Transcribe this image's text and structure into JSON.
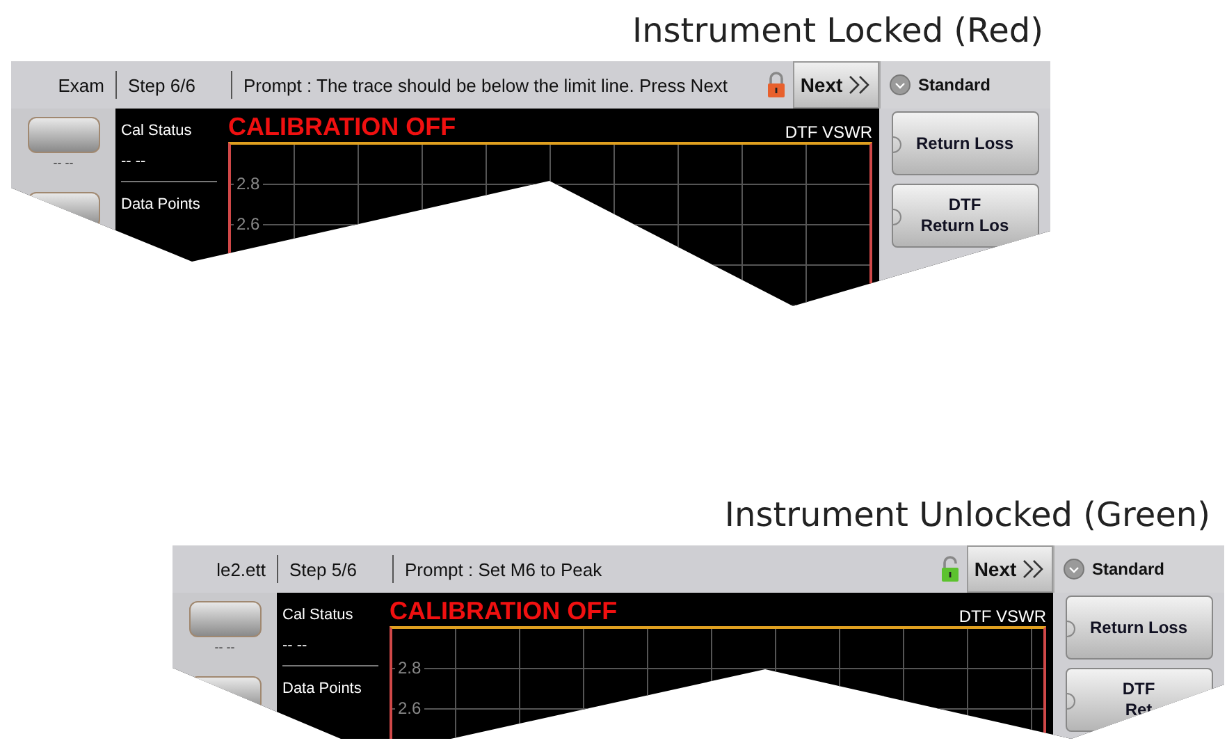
{
  "figures": [
    {
      "caption": "Instrument Locked (Red)",
      "screen": {
        "file_name": "Exam",
        "step": "Step 6/6",
        "prompt": "Prompt : The trace should be below the limit line. Press Next",
        "locked": true,
        "next_button": "Next",
        "mode": "Standard",
        "left_button_label": "-- --",
        "cal_status_label": "Cal Status",
        "cal_status_value": "-- --",
        "data_points_label": "Data Points",
        "calibration": "CALIBRATION OFF",
        "measurement": "DTF VSWR",
        "y_tick_labels": [
          "2.8",
          "2.6"
        ],
        "soft_buttons": [
          {
            "lines": [
              "Return Loss"
            ]
          },
          {
            "lines": [
              "DTF",
              "Return Los"
            ]
          }
        ]
      }
    },
    {
      "caption": "Instrument Unlocked (Green)",
      "screen": {
        "file_name": "le2.ett",
        "step": "Step 5/6",
        "prompt": "Prompt : Set M6 to Peak",
        "locked": false,
        "next_button": "Next",
        "mode": "Standard",
        "left_button_label": "-- --",
        "cal_status_label": "Cal Status",
        "cal_status_value": "-- --",
        "data_points_label": "Data Points",
        "calibration": "CALIBRATION OFF",
        "measurement": "DTF VSWR",
        "y_tick_labels": [
          "2.8",
          "2.6"
        ],
        "soft_buttons": [
          {
            "lines": [
              "Return Loss"
            ]
          },
          {
            "lines": [
              "DTF",
              "Ret"
            ]
          }
        ]
      }
    }
  ]
}
